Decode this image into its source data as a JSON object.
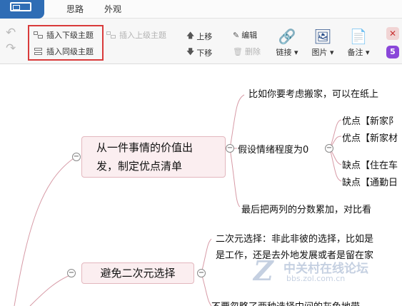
{
  "tabs": {
    "active": "思路",
    "other": "外观"
  },
  "toolbar": {
    "insert_child": "插入下级主题",
    "insert_sibling": "插入同级主题",
    "insert_parent": "插入上级主题",
    "move_up": "上移",
    "move_down": "下移",
    "edit": "编辑",
    "delete": "删除",
    "link": "链接",
    "image": "图片",
    "note": "备注",
    "badge": "5"
  },
  "mindmap": {
    "topic1": "从一件事情的价值出发，制定优点清单",
    "topic1_line1": "从一件事情的价值出",
    "topic1_line2": "发，制定优点清单",
    "branch_a": "比如你要考虑搬家，可以在纸上",
    "branch_b": "假设情绪程度为0",
    "b_items": [
      "优点【新家阝",
      "优点【新家材",
      "缺点【住在车",
      "缺点【通勤日"
    ],
    "branch_c": "最后把两列的分数累加，对比看",
    "topic2": "避免二次元选择",
    "t2_line1": "二次元选择：非此非彼的选择，比如是",
    "t2_line2": "是工作，还是去外地发展或者是留在家",
    "t2_line3": "不要忽略了两种选择中间的灰色地带",
    "watermark_main": "中关村在线论坛",
    "watermark_url": "bbs.zol.com.cn"
  }
}
